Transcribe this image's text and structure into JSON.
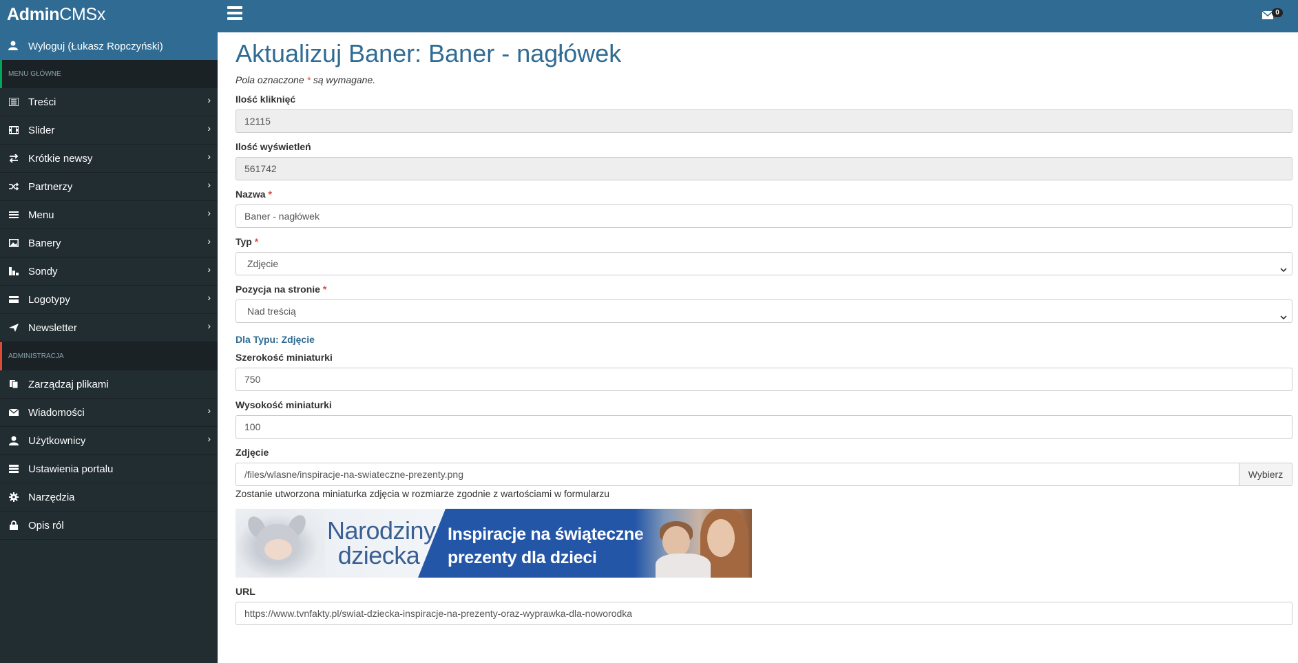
{
  "app": {
    "brand_bold": "Admin",
    "brand_light": "CMSx",
    "mail_count": "0"
  },
  "colors": {
    "topbar": "#2f6b93",
    "sidebar": "#222d32",
    "accent": "#2f6b93",
    "required": "#dd4b39"
  },
  "sidebar": {
    "user_label": "Wyloguj (Łukasz Ropczyński)",
    "sections": [
      {
        "header": "MENU GŁÓWNE",
        "items": [
          {
            "label": "Treści",
            "icon": "list-icon",
            "has_children": true
          },
          {
            "label": "Slider",
            "icon": "film-icon",
            "has_children": true
          },
          {
            "label": "Krótkie newsy",
            "icon": "transfer-icon",
            "has_children": true
          },
          {
            "label": "Partnerzy",
            "icon": "random-icon",
            "has_children": true
          },
          {
            "label": "Menu",
            "icon": "menu-icon",
            "has_children": true
          },
          {
            "label": "Banery",
            "icon": "picture-icon",
            "has_children": true
          },
          {
            "label": "Sondy",
            "icon": "poll-icon",
            "has_children": true
          },
          {
            "label": "Logotypy",
            "icon": "card-icon",
            "has_children": true
          },
          {
            "label": "Newsletter",
            "icon": "send-icon",
            "has_children": true
          }
        ]
      },
      {
        "header": "ADMINISTRACJA",
        "items": [
          {
            "label": "Zarządzaj plikami",
            "icon": "files-icon",
            "has_children": false
          },
          {
            "label": "Wiadomości",
            "icon": "envelope-icon",
            "has_children": true
          },
          {
            "label": "Użytkownicy",
            "icon": "user-icon",
            "has_children": true
          },
          {
            "label": "Ustawienia portalu",
            "icon": "server-icon",
            "has_children": false
          },
          {
            "label": "Narzędzia",
            "icon": "gear-icon",
            "has_children": false
          },
          {
            "label": "Opis ról",
            "icon": "lock-icon",
            "has_children": false
          }
        ]
      }
    ]
  },
  "main": {
    "title": "Aktualizuj Baner: Baner - nagłówek",
    "required_note_prefix": "Pola oznaczone",
    "required_note_star": "*",
    "required_note_suffix": "są wymagane.",
    "fields": {
      "clicks": {
        "label": "Ilość kliknięć",
        "value": "12115"
      },
      "views": {
        "label": "Ilość wyświetleń",
        "value": "561742"
      },
      "name": {
        "label": "Nazwa",
        "value": "Baner - nagłówek"
      },
      "type": {
        "label": "Typ",
        "value": "Zdjęcie"
      },
      "position": {
        "label": "Pozycja na stronie",
        "value": "Nad treścią"
      },
      "thumb_width": {
        "label": "Szerokość miniaturki",
        "value": "750"
      },
      "thumb_height": {
        "label": "Wysokość miniaturki",
        "value": "100"
      },
      "image": {
        "label": "Zdjęcie",
        "value": "/files/wlasne/inspiracje-na-swiateczne-prezenty.png",
        "button": "Wybierz",
        "help": "Zostanie utworzona miniaturka zdjęcia w rozmiarze zgodnie z wartościami w formularzu"
      },
      "url": {
        "label": "URL",
        "value": "https://www.tvnfakty.pl/swiat-dziecka-inspiracje-na-prezenty-oraz-wyprawka-dla-noworodka"
      }
    },
    "subhead": "Dla Typu: Zdjęcie",
    "banner": {
      "line1": "Narodziny",
      "line2": "dziecka",
      "line3": "Inspiracje na świąteczne",
      "line4": "prezenty dla dzieci"
    }
  }
}
